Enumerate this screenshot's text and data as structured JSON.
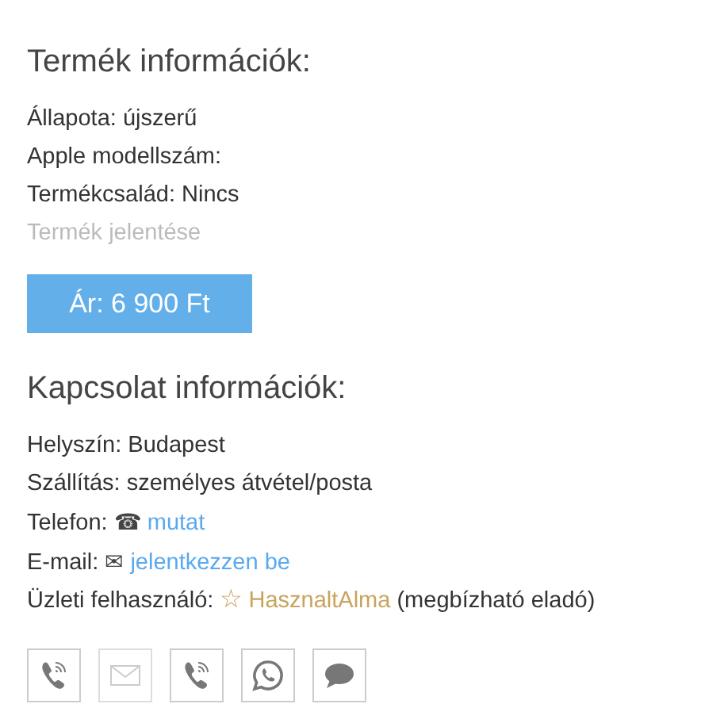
{
  "product": {
    "title": "Termék információk:",
    "rows": [
      "Állapota: újszerű",
      "Apple modellszám:",
      "Termékcsalád: Nincs"
    ],
    "report_link": "Termék jelentése",
    "price_button": "Ár: 6 900 Ft"
  },
  "contact": {
    "title": "Kapcsolat információk:",
    "rows": [
      {
        "kind": "text",
        "label": "Helyszín: Budapest"
      },
      {
        "kind": "text",
        "label": "Szállítás: személyes átvétel/posta"
      },
      {
        "kind": "link",
        "label": "Telefon:",
        "icon": "☎",
        "link": "mutat"
      },
      {
        "kind": "link",
        "label": "E-mail:",
        "icon": "✉",
        "link": "jelentkezzen be"
      },
      {
        "kind": "seller",
        "label": "Üzleti felhasználó:",
        "icon": "☆",
        "link": "HasznaltAlma",
        "suffix": "(megbízható eladó)"
      }
    ]
  },
  "actions": [
    {
      "kind": "phone",
      "disabled": false
    },
    {
      "kind": "email",
      "disabled": true
    },
    {
      "kind": "phone",
      "disabled": false
    },
    {
      "kind": "whatsapp",
      "disabled": false
    },
    {
      "kind": "chat",
      "disabled": false
    }
  ]
}
